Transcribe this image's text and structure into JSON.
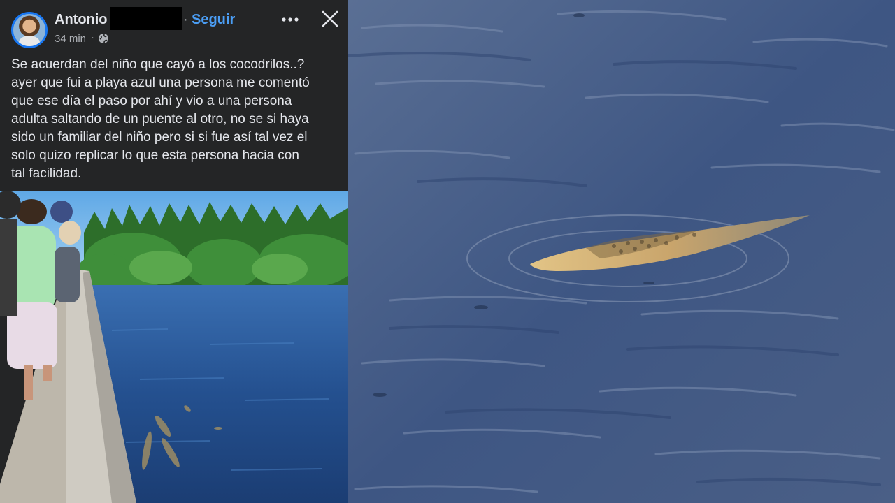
{
  "post": {
    "author": "Antonio V",
    "separator": "·",
    "follow_label": "Seguir",
    "more_icon": "more-options-icon",
    "close_icon": "close-icon",
    "timestamp": "34 min",
    "visibility_icon": "globe-icon",
    "text": "Se acuerdan del niño que cayó a los cocodrilos..?\nayer que fui a playa azul una persona me comentó\nque ese día el paso por ahí y vio a una persona\nadulta saltando de un puente al otro, no se si haya\nsido un familiar del niño pero si si fue así tal vez el\nsolo quizo replicar lo que esta persona hacia con\ntal facilidad."
  },
  "colors": {
    "panel_bg": "#242526",
    "text_primary": "#e4e6eb",
    "text_secondary": "#b0b3b8",
    "link": "#4b9ef5",
    "avatar_ring": "#1877f2"
  }
}
